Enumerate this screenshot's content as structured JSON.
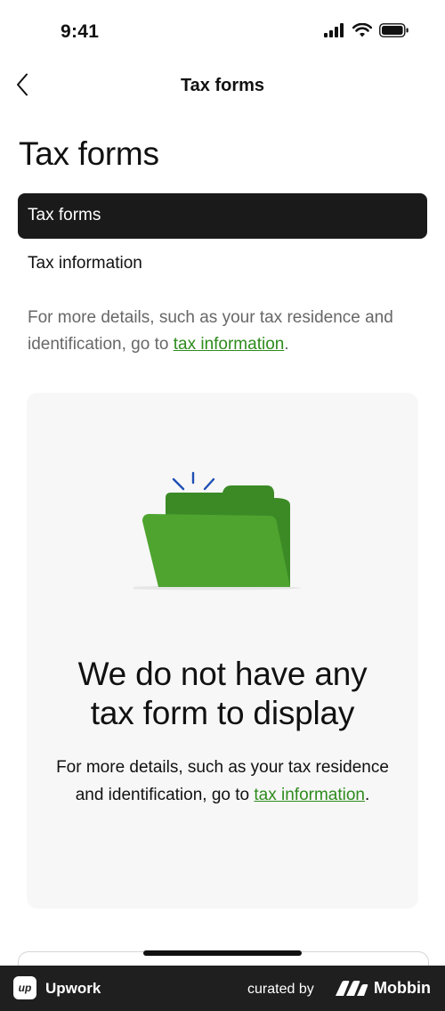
{
  "status_bar": {
    "time": "9:41",
    "icons": [
      "cellular-signal-icon",
      "wifi-icon",
      "battery-icon"
    ]
  },
  "nav": {
    "back_icon": "chevron-left-icon",
    "title": "Tax forms"
  },
  "page": {
    "title": "Tax forms",
    "tabs": [
      {
        "label": "Tax forms",
        "selected": true
      },
      {
        "label": "Tax information",
        "selected": false
      }
    ],
    "info": {
      "text": "For more details, such as your tax residence and identification, go to ",
      "link": "tax information",
      "suffix": "."
    }
  },
  "empty_state": {
    "illustration": "open-folder-illustration",
    "heading_line1": "We do not have any",
    "heading_line2": "tax form to display",
    "description": "For more details, such as your tax residence and identification, go to ",
    "link": "tax information",
    "suffix": "."
  },
  "footer": {
    "app_name": "Upwork",
    "curated_by": "curated by",
    "brand": "Mobbin"
  },
  "colors": {
    "accent_green": "#2e8b1d",
    "folder_green": "#4ea42f",
    "folder_dark_green": "#3c8a26",
    "spark_blue": "#1d4fb5",
    "tab_active_bg": "#1a1a1a",
    "card_bg": "#f7f7f7",
    "footer_bg": "#1f1f1f"
  }
}
